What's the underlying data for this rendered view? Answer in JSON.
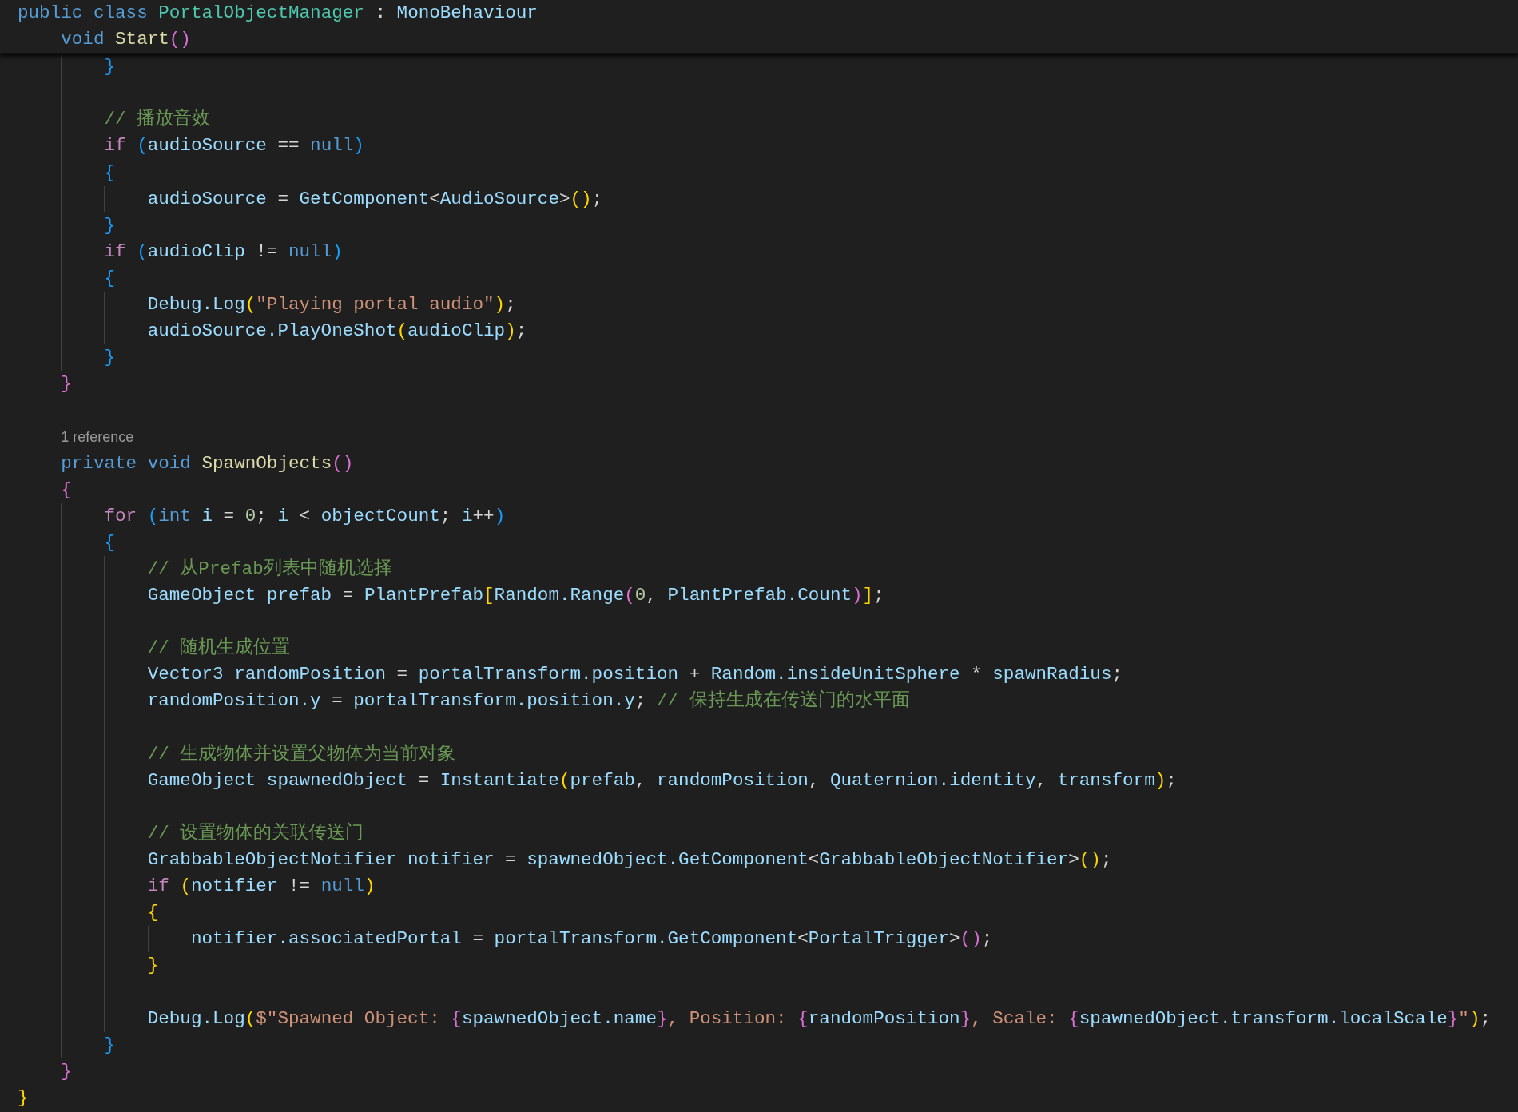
{
  "editor": {
    "sticky_header": [
      {
        "kind": "code",
        "tokens": [
          {
            "text": "public class ",
            "kind": "kw"
          },
          {
            "text": "PortalObjectManager",
            "kind": "type"
          },
          {
            "text": " : ",
            "kind": "punc"
          },
          {
            "text": "MonoBehaviour",
            "kind": "id"
          }
        ],
        "children": [
          {
            "kind": "code",
            "tokens": [
              {
                "text": "void ",
                "kind": "kw"
              },
              {
                "text": "Start",
                "kind": "fn"
              },
              {
                "text": "()",
                "kind": "b2"
              }
            ]
          }
        ]
      }
    ],
    "lines": [
      {
        "kind": "group",
        "children": [
          {
            "kind": "group",
            "children": [
              {
                "kind": "code",
                "tokens": [
                  {
                    "text": "}",
                    "kind": "b3"
                  }
                ]
              },
              {
                "kind": "blank"
              },
              {
                "kind": "code",
                "tokens": [
                  {
                    "text": "// 播放音效",
                    "kind": "cmt"
                  }
                ]
              },
              {
                "kind": "code",
                "tokens": [
                  {
                    "text": "if ",
                    "kind": "ctrl"
                  },
                  {
                    "text": "(",
                    "kind": "b3"
                  },
                  {
                    "text": "audioSource",
                    "kind": "id"
                  },
                  {
                    "text": " == ",
                    "kind": "punc"
                  },
                  {
                    "text": "null",
                    "kind": "kw"
                  },
                  {
                    "text": ")",
                    "kind": "b3"
                  }
                ]
              },
              {
                "kind": "code",
                "tokens": [
                  {
                    "text": "{",
                    "kind": "b3"
                  }
                ],
                "children": [
                  {
                    "kind": "code",
                    "tokens": [
                      {
                        "text": "audioSource",
                        "kind": "id"
                      },
                      {
                        "text": " = ",
                        "kind": "punc"
                      },
                      {
                        "text": "GetComponent",
                        "kind": "id"
                      },
                      {
                        "text": "<",
                        "kind": "punc"
                      },
                      {
                        "text": "AudioSource",
                        "kind": "id"
                      },
                      {
                        "text": ">",
                        "kind": "punc"
                      },
                      {
                        "text": "()",
                        "kind": "b1"
                      },
                      {
                        "text": ";",
                        "kind": "punc"
                      }
                    ]
                  }
                ]
              },
              {
                "kind": "code",
                "tokens": [
                  {
                    "text": "}",
                    "kind": "b3"
                  }
                ]
              },
              {
                "kind": "code",
                "tokens": [
                  {
                    "text": "if ",
                    "kind": "ctrl"
                  },
                  {
                    "text": "(",
                    "kind": "b3"
                  },
                  {
                    "text": "audioClip",
                    "kind": "id"
                  },
                  {
                    "text": " != ",
                    "kind": "punc"
                  },
                  {
                    "text": "null",
                    "kind": "kw"
                  },
                  {
                    "text": ")",
                    "kind": "b3"
                  }
                ]
              },
              {
                "kind": "code",
                "tokens": [
                  {
                    "text": "{",
                    "kind": "b3"
                  }
                ],
                "children": [
                  {
                    "kind": "code",
                    "tokens": [
                      {
                        "text": "Debug.Log",
                        "kind": "id"
                      },
                      {
                        "text": "(",
                        "kind": "b1"
                      },
                      {
                        "text": "\"Playing portal audio\"",
                        "kind": "str"
                      },
                      {
                        "text": ")",
                        "kind": "b1"
                      },
                      {
                        "text": ";",
                        "kind": "punc"
                      }
                    ]
                  },
                  {
                    "kind": "code",
                    "tokens": [
                      {
                        "text": "audioSource.PlayOneShot",
                        "kind": "id"
                      },
                      {
                        "text": "(",
                        "kind": "b1"
                      },
                      {
                        "text": "audioClip",
                        "kind": "id"
                      },
                      {
                        "text": ")",
                        "kind": "b1"
                      },
                      {
                        "text": ";",
                        "kind": "punc"
                      }
                    ]
                  }
                ]
              },
              {
                "kind": "code",
                "tokens": [
                  {
                    "text": "}",
                    "kind": "b3"
                  }
                ]
              }
            ]
          },
          {
            "kind": "code",
            "tokens": [
              {
                "text": "}",
                "kind": "b2"
              }
            ]
          },
          {
            "kind": "blank"
          },
          {
            "kind": "codelens",
            "tokens": [
              {
                "text": "1 reference",
                "kind": "lens"
              }
            ]
          },
          {
            "kind": "code",
            "tokens": [
              {
                "text": "private void ",
                "kind": "kw"
              },
              {
                "text": "SpawnObjects",
                "kind": "fn"
              },
              {
                "text": "()",
                "kind": "b2"
              }
            ]
          },
          {
            "kind": "code",
            "tokens": [
              {
                "text": "{",
                "kind": "b2"
              }
            ],
            "children": [
              {
                "kind": "code",
                "tokens": [
                  {
                    "text": "for ",
                    "kind": "ctrl"
                  },
                  {
                    "text": "(",
                    "kind": "b3"
                  },
                  {
                    "text": "int ",
                    "kind": "kw"
                  },
                  {
                    "text": "i",
                    "kind": "id"
                  },
                  {
                    "text": " = ",
                    "kind": "punc"
                  },
                  {
                    "text": "0",
                    "kind": "num"
                  },
                  {
                    "text": "; ",
                    "kind": "punc"
                  },
                  {
                    "text": "i",
                    "kind": "id"
                  },
                  {
                    "text": " < ",
                    "kind": "punc"
                  },
                  {
                    "text": "objectCount",
                    "kind": "id"
                  },
                  {
                    "text": "; ",
                    "kind": "punc"
                  },
                  {
                    "text": "i",
                    "kind": "id"
                  },
                  {
                    "text": "++",
                    "kind": "punc"
                  },
                  {
                    "text": ")",
                    "kind": "b3"
                  }
                ]
              },
              {
                "kind": "code",
                "tokens": [
                  {
                    "text": "{",
                    "kind": "b3"
                  }
                ],
                "children": [
                  {
                    "kind": "code",
                    "tokens": [
                      {
                        "text": "// 从Prefab列表中随机选择",
                        "kind": "cmt"
                      }
                    ]
                  },
                  {
                    "kind": "code",
                    "tokens": [
                      {
                        "text": "GameObject prefab",
                        "kind": "id"
                      },
                      {
                        "text": " = ",
                        "kind": "punc"
                      },
                      {
                        "text": "PlantPrefab",
                        "kind": "id"
                      },
                      {
                        "text": "[",
                        "kind": "b1"
                      },
                      {
                        "text": "Random.Range",
                        "kind": "id"
                      },
                      {
                        "text": "(",
                        "kind": "b2"
                      },
                      {
                        "text": "0",
                        "kind": "num"
                      },
                      {
                        "text": ", ",
                        "kind": "punc"
                      },
                      {
                        "text": "PlantPrefab.Count",
                        "kind": "id"
                      },
                      {
                        "text": ")",
                        "kind": "b2"
                      },
                      {
                        "text": "]",
                        "kind": "b1"
                      },
                      {
                        "text": ";",
                        "kind": "punc"
                      }
                    ]
                  },
                  {
                    "kind": "blank"
                  },
                  {
                    "kind": "code",
                    "tokens": [
                      {
                        "text": "// 随机生成位置",
                        "kind": "cmt"
                      }
                    ]
                  },
                  {
                    "kind": "code",
                    "tokens": [
                      {
                        "text": "Vector3 randomPosition",
                        "kind": "id"
                      },
                      {
                        "text": " = ",
                        "kind": "punc"
                      },
                      {
                        "text": "portalTransform.position",
                        "kind": "id"
                      },
                      {
                        "text": " + ",
                        "kind": "punc"
                      },
                      {
                        "text": "Random.insideUnitSphere",
                        "kind": "id"
                      },
                      {
                        "text": " * ",
                        "kind": "punc"
                      },
                      {
                        "text": "spawnRadius",
                        "kind": "id"
                      },
                      {
                        "text": ";",
                        "kind": "punc"
                      }
                    ]
                  },
                  {
                    "kind": "code",
                    "tokens": [
                      {
                        "text": "randomPosition.y",
                        "kind": "id"
                      },
                      {
                        "text": " = ",
                        "kind": "punc"
                      },
                      {
                        "text": "portalTransform.position.y",
                        "kind": "id"
                      },
                      {
                        "text": "; ",
                        "kind": "punc"
                      },
                      {
                        "text": "// 保持生成在传送门的水平面",
                        "kind": "cmt"
                      }
                    ]
                  },
                  {
                    "kind": "blank"
                  },
                  {
                    "kind": "code",
                    "tokens": [
                      {
                        "text": "// 生成物体并设置父物体为当前对象",
                        "kind": "cmt"
                      }
                    ]
                  },
                  {
                    "kind": "code",
                    "tokens": [
                      {
                        "text": "GameObject spawnedObject",
                        "kind": "id"
                      },
                      {
                        "text": " = ",
                        "kind": "punc"
                      },
                      {
                        "text": "Instantiate",
                        "kind": "id"
                      },
                      {
                        "text": "(",
                        "kind": "b1"
                      },
                      {
                        "text": "prefab",
                        "kind": "id"
                      },
                      {
                        "text": ", ",
                        "kind": "punc"
                      },
                      {
                        "text": "randomPosition",
                        "kind": "id"
                      },
                      {
                        "text": ", ",
                        "kind": "punc"
                      },
                      {
                        "text": "Quaternion.identity",
                        "kind": "id"
                      },
                      {
                        "text": ", ",
                        "kind": "punc"
                      },
                      {
                        "text": "transform",
                        "kind": "id"
                      },
                      {
                        "text": ")",
                        "kind": "b1"
                      },
                      {
                        "text": ";",
                        "kind": "punc"
                      }
                    ]
                  },
                  {
                    "kind": "blank"
                  },
                  {
                    "kind": "code",
                    "tokens": [
                      {
                        "text": "// 设置物体的关联传送门",
                        "kind": "cmt"
                      }
                    ]
                  },
                  {
                    "kind": "code",
                    "tokens": [
                      {
                        "text": "GrabbableObjectNotifier notifier",
                        "kind": "id"
                      },
                      {
                        "text": " = ",
                        "kind": "punc"
                      },
                      {
                        "text": "spawnedObject.GetComponent",
                        "kind": "id"
                      },
                      {
                        "text": "<",
                        "kind": "punc"
                      },
                      {
                        "text": "GrabbableObjectNotifier",
                        "kind": "id"
                      },
                      {
                        "text": ">",
                        "kind": "punc"
                      },
                      {
                        "text": "()",
                        "kind": "b1"
                      },
                      {
                        "text": ";",
                        "kind": "punc"
                      }
                    ]
                  },
                  {
                    "kind": "code",
                    "tokens": [
                      {
                        "text": "if ",
                        "kind": "ctrl"
                      },
                      {
                        "text": "(",
                        "kind": "b1"
                      },
                      {
                        "text": "notifier",
                        "kind": "id"
                      },
                      {
                        "text": " != ",
                        "kind": "punc"
                      },
                      {
                        "text": "null",
                        "kind": "kw"
                      },
                      {
                        "text": ")",
                        "kind": "b1"
                      }
                    ]
                  },
                  {
                    "kind": "code",
                    "tokens": [
                      {
                        "text": "{",
                        "kind": "b1"
                      }
                    ],
                    "children": [
                      {
                        "kind": "code",
                        "tokens": [
                          {
                            "text": "notifier.associatedPortal",
                            "kind": "id"
                          },
                          {
                            "text": " = ",
                            "kind": "punc"
                          },
                          {
                            "text": "portalTransform.GetComponent",
                            "kind": "id"
                          },
                          {
                            "text": "<",
                            "kind": "punc"
                          },
                          {
                            "text": "PortalTrigger",
                            "kind": "id"
                          },
                          {
                            "text": ">",
                            "kind": "punc"
                          },
                          {
                            "text": "()",
                            "kind": "b2"
                          },
                          {
                            "text": ";",
                            "kind": "punc"
                          }
                        ]
                      }
                    ]
                  },
                  {
                    "kind": "code",
                    "tokens": [
                      {
                        "text": "}",
                        "kind": "b1"
                      }
                    ]
                  },
                  {
                    "kind": "blank"
                  },
                  {
                    "kind": "code",
                    "tokens": [
                      {
                        "text": "Debug.Log",
                        "kind": "id"
                      },
                      {
                        "text": "(",
                        "kind": "b1"
                      },
                      {
                        "text": "$\"Spawned Object: ",
                        "kind": "str"
                      },
                      {
                        "text": "{",
                        "kind": "b2"
                      },
                      {
                        "text": "spawnedObject.name",
                        "kind": "id"
                      },
                      {
                        "text": "}",
                        "kind": "b2"
                      },
                      {
                        "text": ", Position: ",
                        "kind": "str"
                      },
                      {
                        "text": "{",
                        "kind": "b2"
                      },
                      {
                        "text": "randomPosition",
                        "kind": "id"
                      },
                      {
                        "text": "}",
                        "kind": "b2"
                      },
                      {
                        "text": ", Scale: ",
                        "kind": "str"
                      },
                      {
                        "text": "{",
                        "kind": "b2"
                      },
                      {
                        "text": "spawnedObject.transform.localScale",
                        "kind": "id"
                      },
                      {
                        "text": "}",
                        "kind": "b2"
                      },
                      {
                        "text": "\"",
                        "kind": "str"
                      },
                      {
                        "text": ")",
                        "kind": "b1"
                      },
                      {
                        "text": ";",
                        "kind": "punc"
                      }
                    ]
                  }
                ]
              },
              {
                "kind": "code",
                "tokens": [
                  {
                    "text": "}",
                    "kind": "b3"
                  }
                ]
              }
            ]
          },
          {
            "kind": "code",
            "tokens": [
              {
                "text": "}",
                "kind": "b2"
              }
            ]
          }
        ]
      },
      {
        "kind": "code",
        "tokens": [
          {
            "text": "}",
            "kind": "b1"
          }
        ]
      }
    ]
  }
}
